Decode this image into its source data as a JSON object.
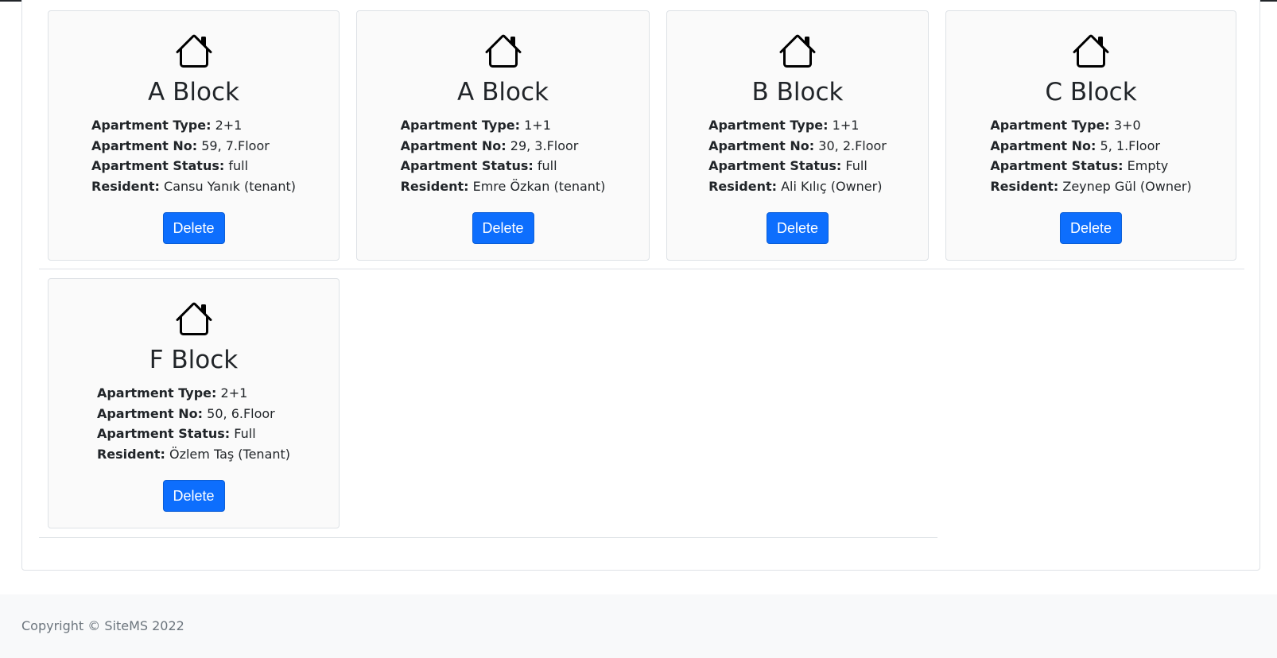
{
  "cards": [
    {
      "title": "A Block",
      "type_label": "Apartment Type:",
      "type": "2+1",
      "no_label": "Apartment No:",
      "no": "59, 7.Floor",
      "status_label": "Apartment Status:",
      "status": "full",
      "resident_label": "Resident:",
      "resident": "Cansu Yanık (tenant)",
      "delete_label": "Delete"
    },
    {
      "title": "A Block",
      "type_label": "Apartment Type:",
      "type": "1+1",
      "no_label": "Apartment No:",
      "no": "29, 3.Floor",
      "status_label": "Apartment Status:",
      "status": "full",
      "resident_label": "Resident:",
      "resident": "Emre Özkan (tenant)",
      "delete_label": "Delete"
    },
    {
      "title": "B Block",
      "type_label": "Apartment Type:",
      "type": "1+1",
      "no_label": "Apartment No:",
      "no": "30, 2.Floor",
      "status_label": "Apartment Status:",
      "status": "Full",
      "resident_label": "Resident:",
      "resident": "Ali Kılıç (Owner)",
      "delete_label": "Delete"
    },
    {
      "title": "C Block",
      "type_label": "Apartment Type:",
      "type": "3+0",
      "no_label": "Apartment No:",
      "no": "5, 1.Floor",
      "status_label": "Apartment Status:",
      "status": "Empty",
      "resident_label": "Resident:",
      "resident": "Zeynep Gül (Owner)",
      "delete_label": "Delete"
    },
    {
      "title": "F Block",
      "type_label": "Apartment Type:",
      "type": "2+1",
      "no_label": "Apartment No:",
      "no": "50, 6.Floor",
      "status_label": "Apartment Status:",
      "status": "Full",
      "resident_label": "Resident:",
      "resident": "Özlem Taş (Tenant)",
      "delete_label": "Delete"
    }
  ],
  "icons": {
    "card_icon": "house-icon"
  },
  "colors": {
    "primary": "#0d6efd",
    "card_bg": "#fafafa",
    "footer_bg": "#f8f9fa",
    "text": "#212529",
    "muted": "#6c757d"
  },
  "footer": {
    "copyright": "Copyright © SiteMS 2022"
  }
}
